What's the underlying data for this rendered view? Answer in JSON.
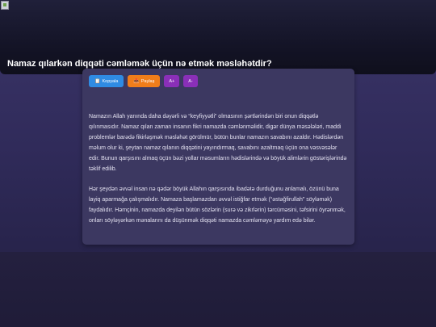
{
  "hero": {
    "title": "Namaz qılarkən diqqəti cəmləmək üçün nə etmək məsləhətdir?"
  },
  "toolbar": {
    "copy_icon": "clipboard-icon",
    "copy_label": "Kopyala",
    "share_icon": "share-icon",
    "share_label": "Paylaş",
    "font_increase_label": "A+",
    "font_decrease_label": "A-"
  },
  "colors": {
    "copy_button": "#2f8be3",
    "share_button": "#f07d1a",
    "font_buttons": "#8a2fb8"
  },
  "article": {
    "paragraphs": [
      "Namazın Allah yanında daha dəyərli və “keyfiyyətli” olmasının şərtlərindən biri onun diqqətlə qılınmasıdır. Namaz qılan zaman insanın fikri namazda cəmlənməlidir, digər dünya məsələləri, maddi problemlər barədə fikirləşmək məsləhət görülmür, bütün bunlar namazın savabını azaldır. Hədislərdən məlum olur ki, şeytan namaz qılanın diqqətini yayındırmaq, savabını azaltmaq üçün ona vəsvəsələr edir. Bunun qarşısını almaq üçün bəzi yollar məsumların hədislərində və böyük alimlərin göstərişlərində təklif edilib.",
      "Hər şeydən əvvəl insan nə qədər böyük Allahın qarşısında ibadətə durduğunu anlamalı, özünü buna layiq aparmağa çalışmalıdır. Namaza başlamazdan əvvəl istiğfar etmək (“əstəğfirullah” söyləmək) faydalıdır. Həmçinin, namazda deyilən bütün sözlərin (surə və zikrlərin) tərcüməsini, təfsirini öyrənmək, onları söyləyərkən mənalarını da düşünmək diqqəti namazda cəmləməyə yardım edə bilər."
    ]
  }
}
